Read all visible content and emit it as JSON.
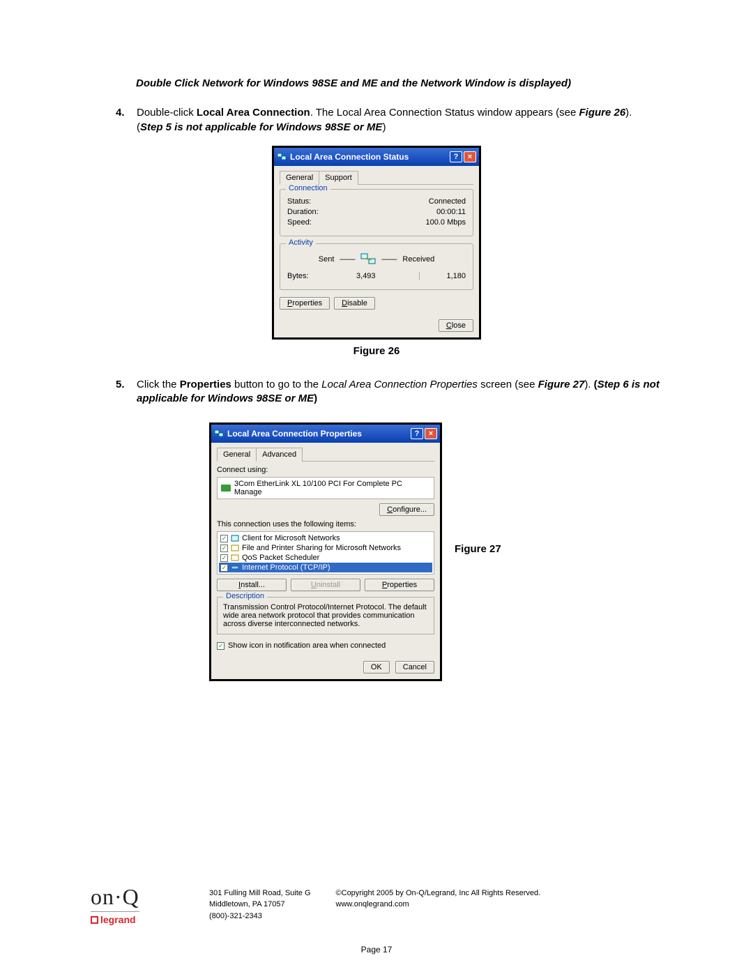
{
  "intro_italic": "Double Click Network for Windows 98SE and ME and the Network Window is displayed)",
  "step4": {
    "num": "4.",
    "pre": "Double-click ",
    "bold1": "Local Area Connection",
    "mid": ". The Local Area Connection Status window appears (see ",
    "figref": "Figure 26",
    "post": ").",
    "note": "Step 5 is not applicable for Windows 98SE or ME",
    "note_close": ")"
  },
  "fig26": {
    "title": "Local Area Connection Status",
    "tabs": [
      "General",
      "Support"
    ],
    "conn_legend": "Connection",
    "status_label": "Status:",
    "status_val": "Connected",
    "duration_label": "Duration:",
    "duration_val": "00:00:11",
    "speed_label": "Speed:",
    "speed_val": "100.0 Mbps",
    "act_legend": "Activity",
    "sent": "Sent",
    "received": "Received",
    "bytes_label": "Bytes:",
    "sent_val": "3,493",
    "recv_val": "1,180",
    "btn_props": "Properties",
    "btn_disable": "Disable",
    "btn_close": "Close",
    "caption": "Figure 26"
  },
  "step5": {
    "num": "5.",
    "pre": "Click the ",
    "bold1": "Properties",
    "mid": " button to go to the ",
    "ital1": "Local Area Connection Properties",
    "post": " screen (see ",
    "figref": "Figure 27",
    "post2": "). ",
    "note_open": "(",
    "note": "Step 6 is not applicable for Windows 98SE or ME",
    "note_close": ")"
  },
  "fig27": {
    "title": "Local Area Connection Properties",
    "tabs": [
      "General",
      "Advanced"
    ],
    "connect_using": "Connect using:",
    "nic": "3Com EtherLink XL 10/100 PCI For Complete PC Manage",
    "btn_configure": "Configure...",
    "uses_items": "This connection uses the following items:",
    "items": [
      "Client for Microsoft Networks",
      "File and Printer Sharing for Microsoft Networks",
      "QoS Packet Scheduler",
      "Internet Protocol (TCP/IP)"
    ],
    "btn_install": "Install...",
    "btn_uninstall": "Uninstall",
    "btn_props": "Properties",
    "desc_legend": "Description",
    "desc_text": "Transmission Control Protocol/Internet Protocol. The default wide area network protocol that provides communication across diverse interconnected networks.",
    "show_icon": "Show icon in notification area when connected",
    "btn_ok": "OK",
    "btn_cancel": "Cancel",
    "caption": "Figure 27"
  },
  "footer": {
    "addr1": "301 Fulling Mill Road, Suite G",
    "addr2": "Middletown, PA   17057",
    "phone": "(800)-321-2343",
    "copyright": "©Copyright 2005 by On-Q/Legrand, Inc All Rights Reserved.",
    "url": "www.onqlegrand.com",
    "onq": "on·Q",
    "legrand": "legrand"
  },
  "page_num": "Page 17"
}
